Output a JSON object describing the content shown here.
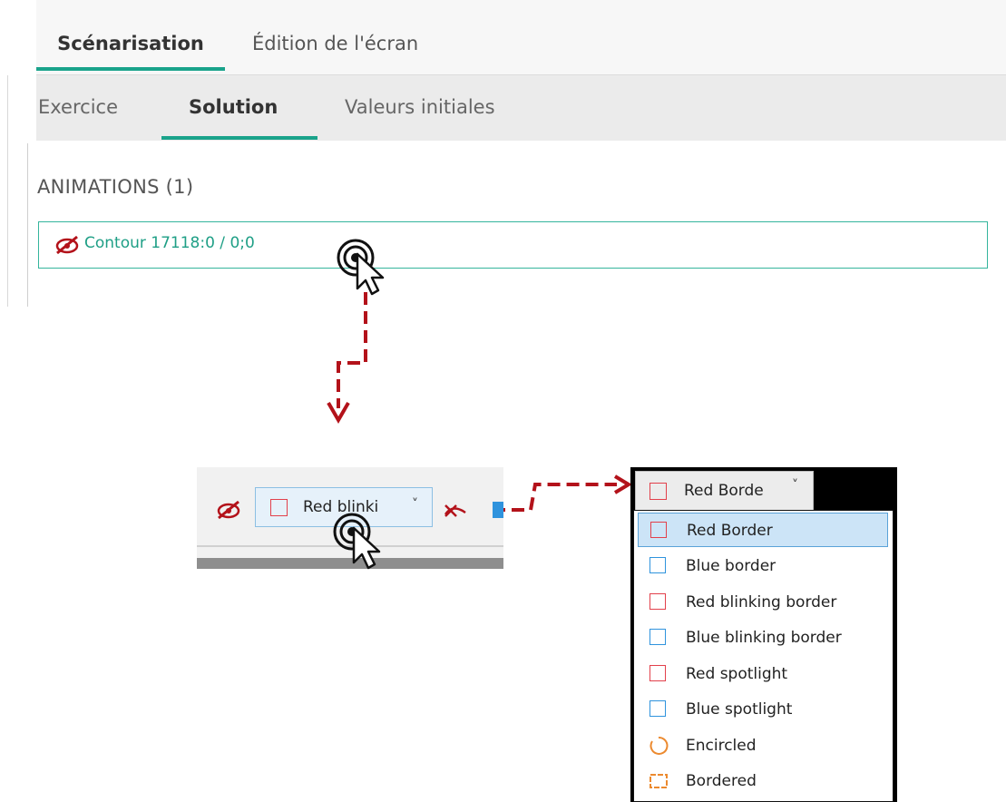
{
  "top": {
    "main_tabs": [
      {
        "label": "Scénarisation",
        "active": true
      },
      {
        "label": "Édition de l'écran",
        "active": false
      }
    ],
    "sub_tabs": [
      {
        "label": "Exercice",
        "active": false
      },
      {
        "label": "Solution",
        "active": true
      },
      {
        "label": "Valeurs initiales",
        "active": false
      }
    ],
    "animations_title": "ANIMATIONS (1)",
    "animation_item": {
      "label": "Contour 17118:0 / 0;0",
      "icon": "eye-strike-icon"
    }
  },
  "toolbar": {
    "select_value": "Red blinki",
    "chevron": "˅"
  },
  "dropdown": {
    "current_value": "Red Borde",
    "chevron": "˅",
    "options": [
      {
        "label": "Red Border",
        "icon": "red-square-icon",
        "color": "#e2404b",
        "selected": true
      },
      {
        "label": "Blue border",
        "icon": "blue-square-icon",
        "color": "#2f93dd",
        "selected": false
      },
      {
        "label": "Red blinking border",
        "icon": "red-square-icon",
        "color": "#e2404b",
        "selected": false
      },
      {
        "label": "Blue blinking border",
        "icon": "blue-square-icon",
        "color": "#2f93dd",
        "selected": false
      },
      {
        "label": "Red spotlight",
        "icon": "red-square-icon",
        "color": "#e2404b",
        "selected": false
      },
      {
        "label": "Blue spotlight",
        "icon": "blue-square-icon",
        "color": "#2f93dd",
        "selected": false
      },
      {
        "label": "Encircled",
        "icon": "orange-circle-icon",
        "color": "#ec8a2f",
        "selected": false
      },
      {
        "label": "Bordered",
        "icon": "orange-frame-icon",
        "color": "#ec8a2f",
        "selected": false
      }
    ]
  },
  "colors": {
    "accent": "#1aa38b",
    "arrow": "#b3121a",
    "animation_text": "#1f9f86"
  }
}
